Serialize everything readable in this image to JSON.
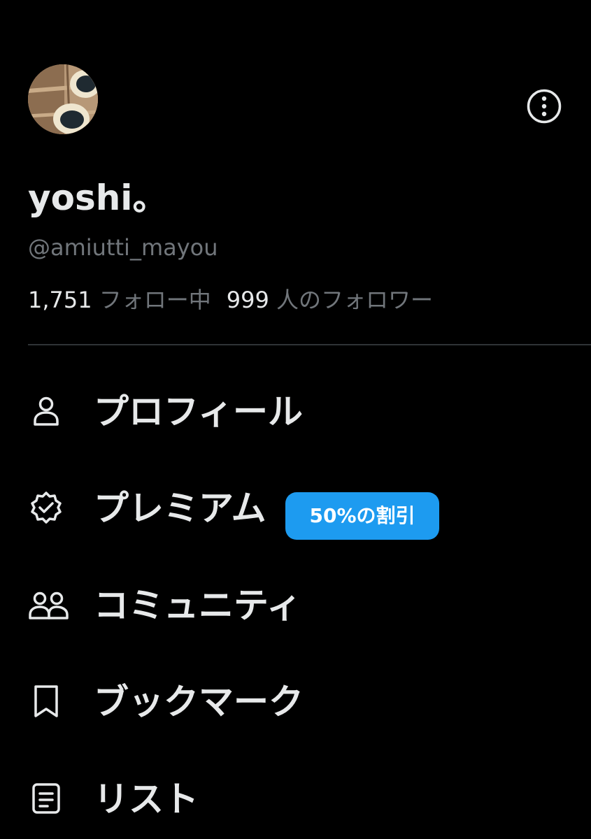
{
  "profile": {
    "display_name": "yoshi。",
    "handle": "@amiutti_mayou",
    "avatar_icon": "avatar-photo",
    "more_icon": "more-vertical-circle-icon"
  },
  "stats": {
    "following_count": "1,751",
    "following_label": "フォロー中",
    "followers_count": "999",
    "followers_label": "人のフォロワー"
  },
  "menu": {
    "items": [
      {
        "label": "プロフィール",
        "icon": "person-icon"
      },
      {
        "label": "プレミアム",
        "icon": "verified-badge-icon",
        "badge": "50%の割引"
      },
      {
        "label": "コミュニティ",
        "icon": "people-icon"
      },
      {
        "label": "ブックマーク",
        "icon": "bookmark-icon"
      },
      {
        "label": "リスト",
        "icon": "list-icon"
      }
    ]
  },
  "colors": {
    "background": "#000000",
    "text_primary": "#e7e9ea",
    "text_secondary": "#71767b",
    "accent": "#1d9bf0",
    "divider": "#2f3336"
  }
}
